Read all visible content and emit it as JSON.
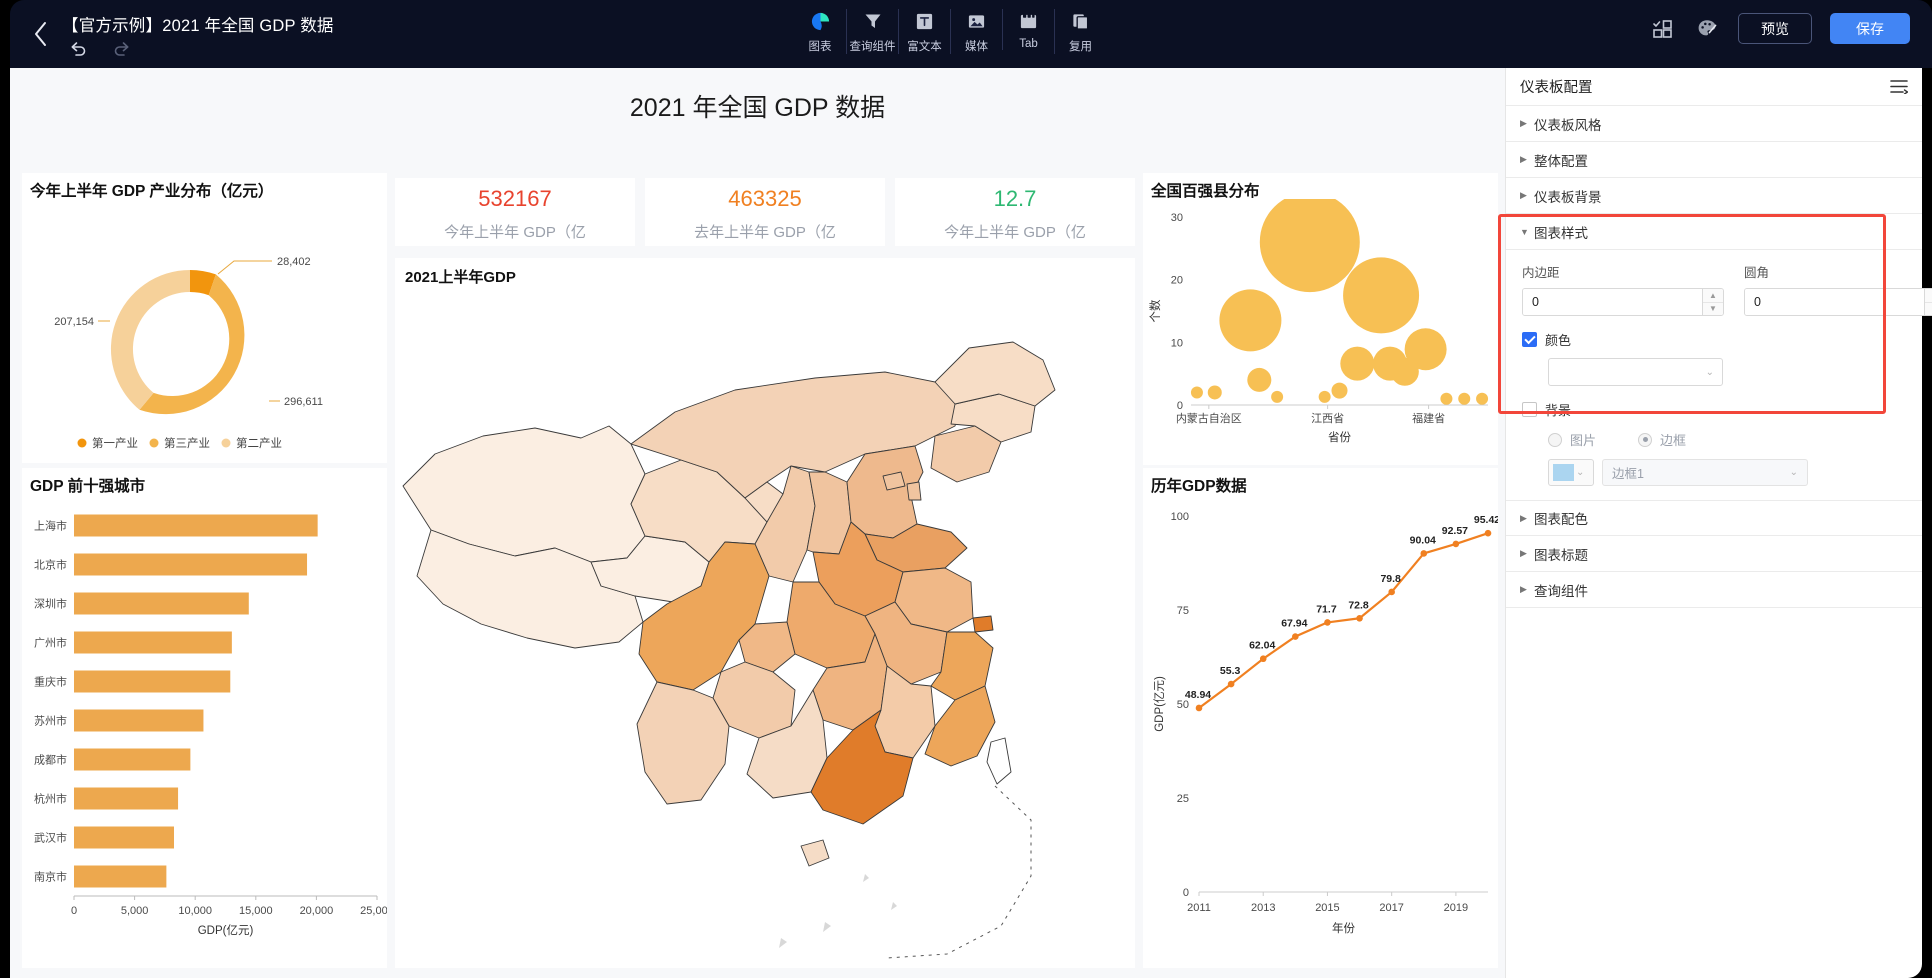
{
  "topbar": {
    "doc_title": "【官方示例】2021 年全国 GDP 数据",
    "back_icon": "chevron-left-icon",
    "undo_icon": "undo-icon",
    "redo_icon": "redo-icon",
    "tools": [
      {
        "label": "图表",
        "icon": "pie-chart-icon"
      },
      {
        "label": "查询组件",
        "icon": "filter-icon"
      },
      {
        "label": "富文本",
        "icon": "text-box-icon"
      },
      {
        "label": "媒体",
        "icon": "image-icon"
      },
      {
        "label": "Tab",
        "icon": "tab-icon"
      },
      {
        "label": "复用",
        "icon": "copy-icon"
      }
    ],
    "grid_icon": "layout-grid-icon",
    "theme_icon": "palette-icon",
    "preview_label": "预览",
    "save_label": "保存",
    "save_color": "#4285f4"
  },
  "dashboard": {
    "title": "2021 年全国 GDP 数据",
    "kpis": [
      {
        "value": "532167",
        "label": "今年上半年 GDP（亿",
        "color": "#e8432e"
      },
      {
        "value": "463325",
        "label": "去年上半年 GDP（亿",
        "color": "#f08021"
      },
      {
        "value": "12.7",
        "label": "今年上半年 GDP（亿",
        "color": "#2eb872"
      }
    ],
    "map": {
      "title": "2021上半年GDP",
      "type": "choropleth-china",
      "palette": [
        "#fbeee2",
        "#f8e0cb",
        "#f5cfae",
        "#f0b887",
        "#e99a58",
        "#e07c2a"
      ]
    }
  },
  "panel": {
    "title": "仪表板配置",
    "menu_icon": "list-settings-icon",
    "sections": [
      {
        "label": "仪表板风格",
        "open": false
      },
      {
        "label": "整体配置",
        "open": false
      },
      {
        "label": "仪表板背景",
        "open": false
      },
      {
        "label": "图表样式",
        "open": true
      },
      {
        "label": "图表配色",
        "open": false
      },
      {
        "label": "图表标题",
        "open": false
      },
      {
        "label": "查询组件",
        "open": false
      }
    ],
    "chart_style": {
      "padding_label": "内边距",
      "padding_value": "0",
      "radius_label": "圆角",
      "radius_value": "0",
      "color_label": "颜色",
      "color_checked": true,
      "color_value": "",
      "background_label": "背景",
      "background_checked": false,
      "radio_image_label": "图片",
      "radio_border_label": "边框",
      "radio_selected": "边框",
      "swatch_color": "#abd5f0",
      "border_value": "边框1"
    },
    "highlight_color": "#f2463a"
  },
  "chart_data": [
    {
      "id": "donut",
      "type": "pie",
      "title": "今年上半年 GDP 产业分布（亿元）",
      "labels": [
        "第一产业",
        "第三产业",
        "第二产业"
      ],
      "values": [
        28402,
        296611,
        207154
      ],
      "display_values": [
        "28,402",
        "296,611",
        "207,154"
      ],
      "colors": [
        "#f2950d",
        "#f3b44c",
        "#f6d19a"
      ],
      "legend": [
        "第一产业",
        "第三产业",
        "第二产业"
      ],
      "legend_position": "bottom"
    },
    {
      "id": "bar",
      "type": "bar",
      "title": "GDP 前十强城市",
      "orientation": "horizontal",
      "categories": [
        "上海市",
        "北京市",
        "深圳市",
        "广州市",
        "重庆市",
        "苏州市",
        "成都市",
        "杭州市",
        "武汉市",
        "南京市"
      ],
      "values": [
        20103,
        19228,
        14422,
        13025,
        12895,
        10680,
        9602,
        8586,
        8251,
        7622
      ],
      "xlabel": "GDP(亿元)",
      "ylabel": "",
      "xlim": [
        0,
        25000
      ],
      "xticks": [
        "0",
        "5,000",
        "10,000",
        "15,000",
        "20,000",
        "25,000"
      ],
      "color": "#eda84e",
      "grid": false
    },
    {
      "id": "bubble",
      "type": "scatter",
      "title": "全国百强县分布",
      "xlabel": "省份",
      "ylabel": "个数",
      "ylim": [
        0,
        30
      ],
      "yticks": [
        "0",
        "10",
        "20",
        "30"
      ],
      "xticks": [
        "内蒙古自治区",
        "江西省",
        "福建省"
      ],
      "color": "#f7c054",
      "points": [
        {
          "x": 0.02,
          "y": 2.0,
          "size": 6
        },
        {
          "x": 0.08,
          "y": 2.0,
          "size": 7
        },
        {
          "x": 0.2,
          "y": 13.5,
          "size": 31
        },
        {
          "x": 0.23,
          "y": 4.0,
          "size": 12
        },
        {
          "x": 0.29,
          "y": 1.3,
          "size": 6
        },
        {
          "x": 0.4,
          "y": 26.0,
          "size": 50
        },
        {
          "x": 0.45,
          "y": 1.3,
          "size": 6
        },
        {
          "x": 0.5,
          "y": 2.3,
          "size": 8
        },
        {
          "x": 0.56,
          "y": 6.6,
          "size": 17
        },
        {
          "x": 0.64,
          "y": 17.5,
          "size": 38
        },
        {
          "x": 0.67,
          "y": 6.6,
          "size": 17
        },
        {
          "x": 0.72,
          "y": 5.3,
          "size": 14
        },
        {
          "x": 0.79,
          "y": 8.9,
          "size": 21
        },
        {
          "x": 0.86,
          "y": 1.0,
          "size": 6
        },
        {
          "x": 0.92,
          "y": 1.0,
          "size": 6
        },
        {
          "x": 0.98,
          "y": 1.0,
          "size": 6
        }
      ]
    },
    {
      "id": "line",
      "type": "line",
      "title": "历年GDP数据",
      "xlabel": "年份",
      "ylabel": "GDP(亿元)",
      "ylim": [
        0,
        100
      ],
      "yticks": [
        "0",
        "25",
        "50",
        "75",
        "100"
      ],
      "x": [
        2011,
        2012,
        2013,
        2014,
        2015,
        2016,
        2017,
        2018,
        2019,
        2020
      ],
      "xticks": [
        "2011",
        "2013",
        "2015",
        "2017",
        "2019"
      ],
      "values": [
        48.94,
        55.3,
        62.04,
        67.94,
        71.7,
        72.8,
        79.8,
        90.04,
        92.57,
        95.42
      ],
      "data_labels": [
        "48.94",
        "55.3",
        "62.04",
        "67.94",
        "71.7",
        "72.8",
        "79.8",
        "90.04",
        "92.57",
        "95.42"
      ],
      "color": "#f08021"
    }
  ]
}
